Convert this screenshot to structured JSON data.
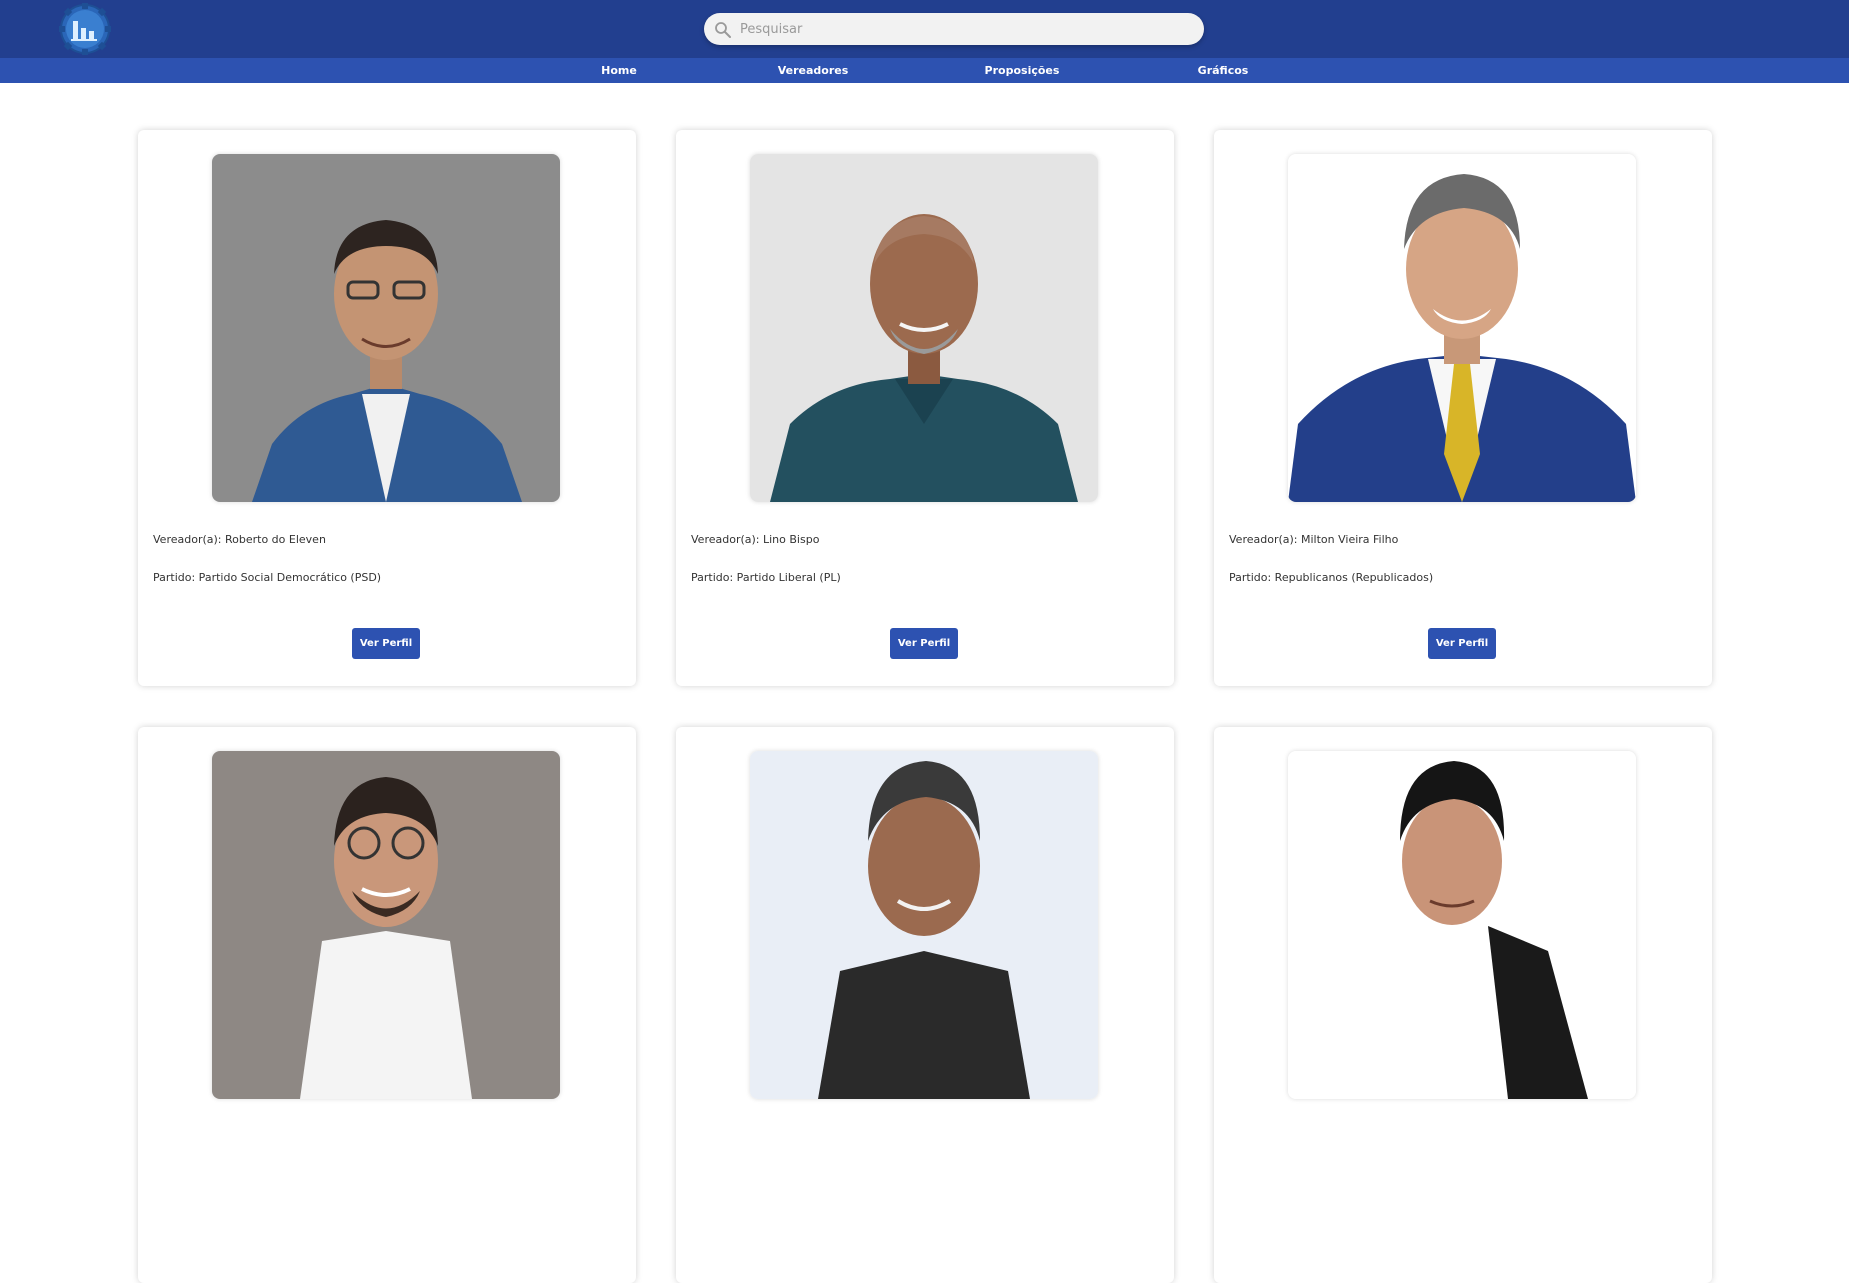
{
  "header": {
    "logo_name": "bar-chart-gear-logo",
    "search": {
      "placeholder": "Pesquisar",
      "value": ""
    }
  },
  "nav": [
    {
      "label": "Home"
    },
    {
      "label": "Vereadores"
    },
    {
      "label": "Proposições"
    },
    {
      "label": "Gráficos"
    }
  ],
  "cards": [
    {
      "name": "Vereador(a): Roberto do Eleven",
      "party": "Partido: Partido Social Democrático (PSD)",
      "button": "Ver Perfil"
    },
    {
      "name": "Vereador(a): Lino Bispo",
      "party": "Partido: Partido Liberal (PL)",
      "button": "Ver Perfil"
    },
    {
      "name": "Vereador(a): Milton Vieira Filho",
      "party": "Partido: Republicanos (Republicados)",
      "button": "Ver Perfil"
    },
    {
      "name": "",
      "party": "",
      "button": ""
    },
    {
      "name": "",
      "party": "",
      "button": ""
    },
    {
      "name": "",
      "party": "",
      "button": ""
    }
  ],
  "colors": {
    "header_bg": "#223f8f",
    "nav_bg": "#2d52b1",
    "button_bg": "#2d52b1"
  }
}
